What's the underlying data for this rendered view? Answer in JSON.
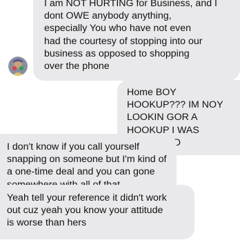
{
  "messages": [
    {
      "direction": "incoming",
      "text": "I am NOT HURTING for Business, and I\ndont OWE anybody anything,\nespecially You who have not even\nhad the courtesy of stopping into our\nbusiness as opposed to shopping\nover the phone"
    },
    {
      "direction": "outgoing",
      "text": "Home BOY HOOKUP??? IM NOY\nLOOKIN GOR A HOOKUP I WAS\nREFERRED"
    },
    {
      "direction": "incoming",
      "text": "I don't know if you call yourself\nsnapping on someone but I'm kind of\na one-time deal and you can gone\nsomewhere with all of that"
    },
    {
      "direction": "incoming",
      "text": "Yeah tell your reference it didn't work\nout cuz yeah you know your attitude\nis worse than hers"
    }
  ],
  "colors": {
    "bubble_bg": "#e9e9eb",
    "text": "#111111"
  },
  "icons": {
    "avatar": "contact-avatar-icon"
  }
}
